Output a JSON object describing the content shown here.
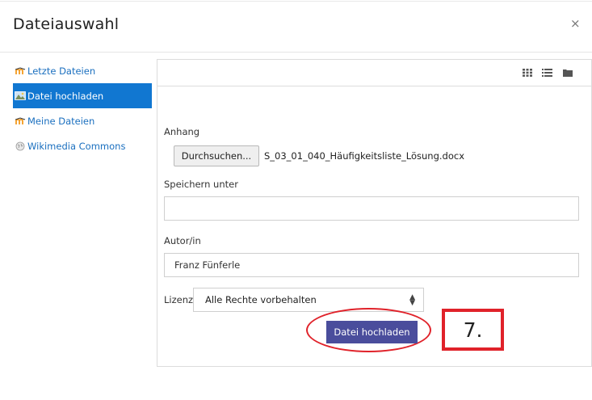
{
  "dialog": {
    "title": "Dateiauswahl",
    "close_label": "×"
  },
  "sidebar": {
    "items": [
      {
        "label": "Letzte Dateien",
        "icon": "moodle-icon"
      },
      {
        "label": "Datei hochladen",
        "icon": "upload-icon",
        "active": true
      },
      {
        "label": "Meine Dateien",
        "icon": "moodle-icon"
      },
      {
        "label": "Wikimedia Commons",
        "icon": "wikimedia-icon"
      }
    ]
  },
  "toolbar": {
    "views": [
      "grid-view-icon",
      "list-view-icon",
      "folder-view-icon"
    ]
  },
  "form": {
    "attachment_label": "Anhang",
    "browse_label": "Durchsuchen...",
    "filename": "S_03_01_040_Häufigkeitsliste_Lösung.docx",
    "save_as_label": "Speichern unter",
    "save_as_value": "",
    "author_label": "Autor/in",
    "author_value": "Franz Fünferle",
    "license_label": "Lizenz",
    "license_value": "Alle Rechte vorbehalten",
    "upload_button": "Datei hochladen"
  },
  "annotation": {
    "step_label": "7.",
    "color": "#e0222a"
  },
  "colors": {
    "accent": "#1177d1",
    "button": "#4a4d9c",
    "link": "#1a6fbf"
  }
}
